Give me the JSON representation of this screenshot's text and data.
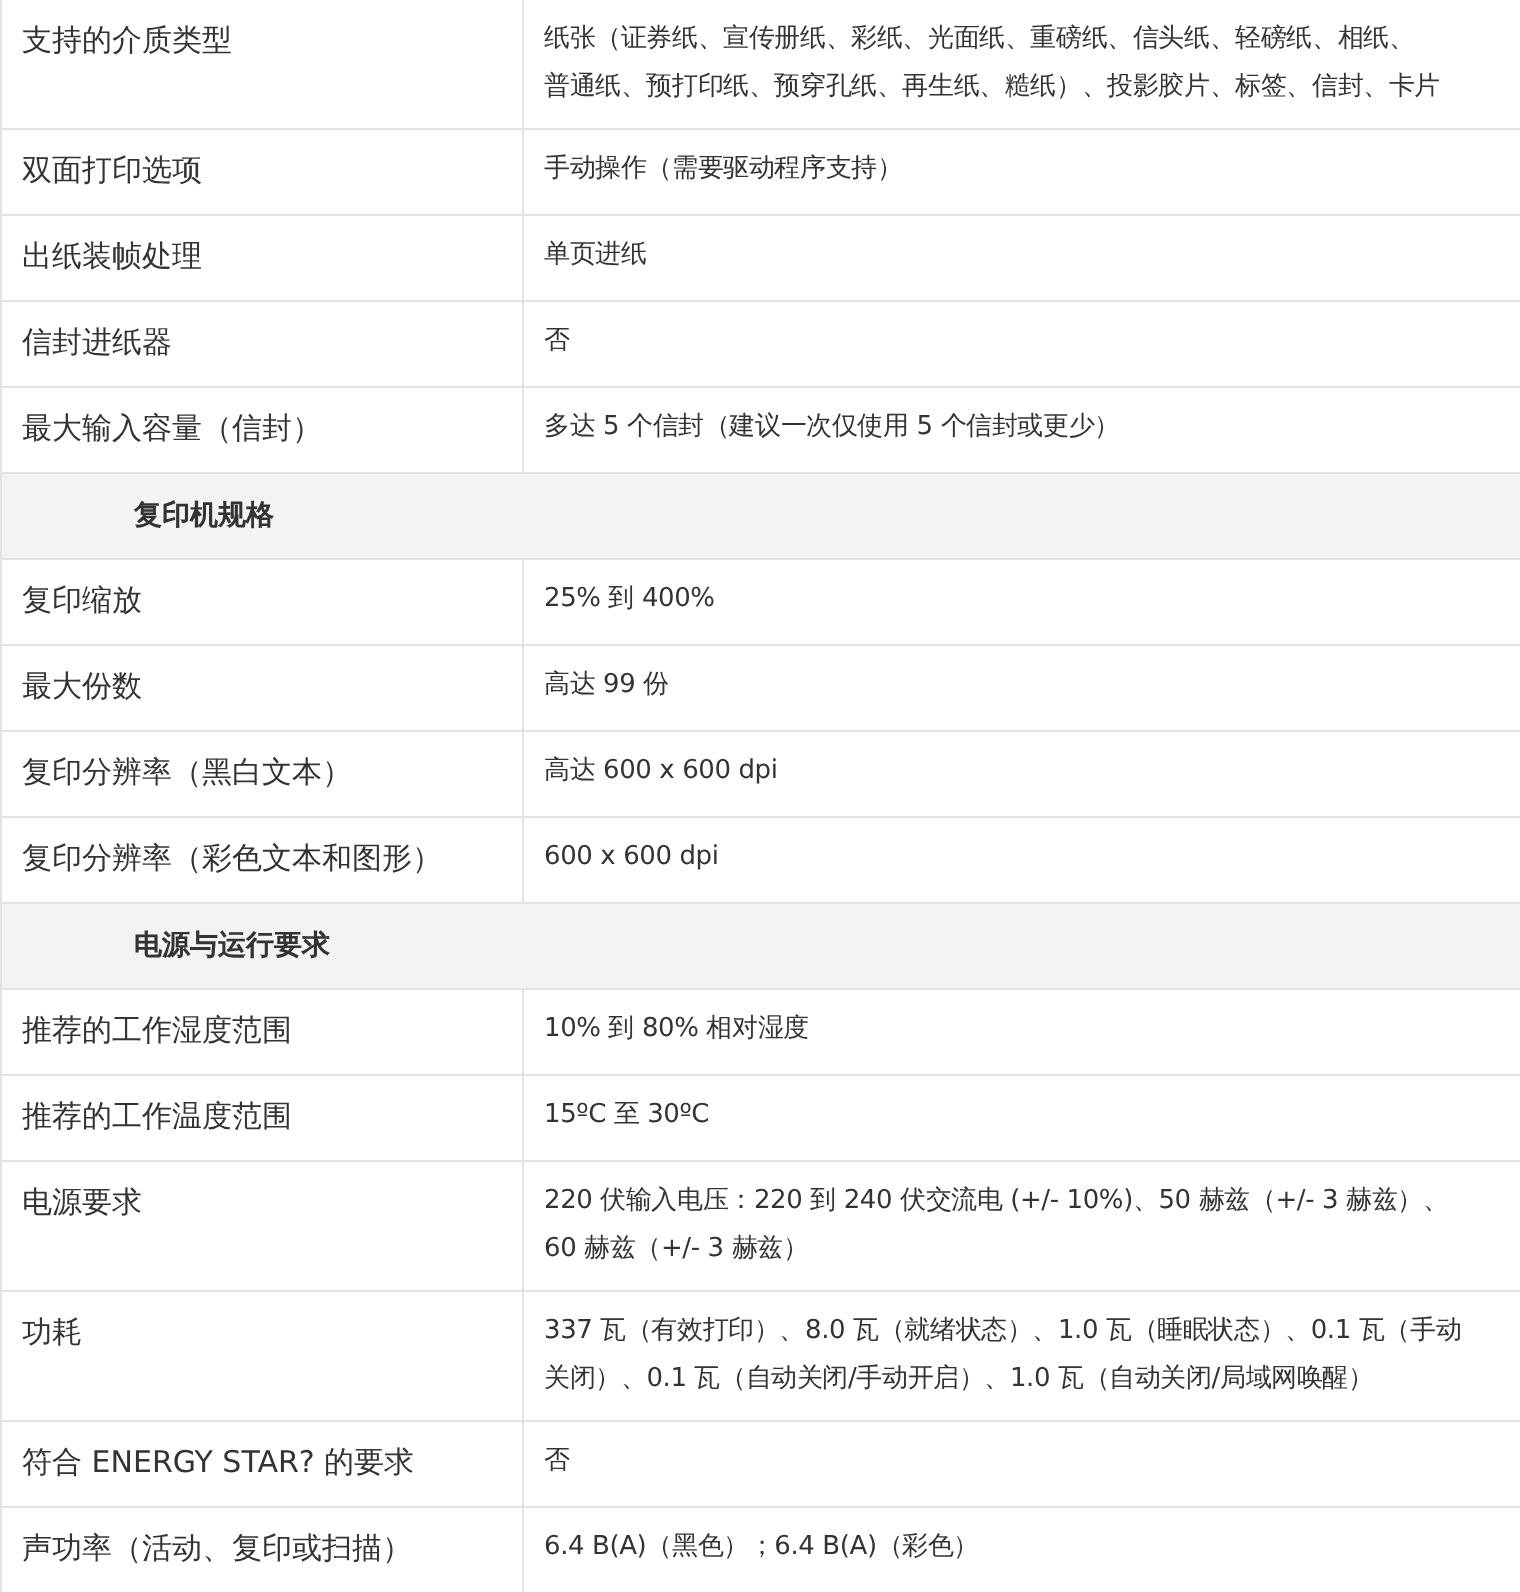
{
  "rows": [
    {
      "kind": "spec",
      "label": "支持的介质类型",
      "lines": [
        "纸张（证券纸、宣传册纸、彩纸、光面纸、重磅纸、信头纸、轻磅纸、相纸、",
        "普通纸、预打印纸、预穿孔纸、再生纸、糙纸）、投影胶片、标签、信封、卡片"
      ]
    },
    {
      "kind": "spec",
      "label": "双面打印选项",
      "lines": [
        "手动操作（需要驱动程序支持）"
      ]
    },
    {
      "kind": "spec",
      "label": "出纸装帧处理",
      "lines": [
        "单页进纸"
      ]
    },
    {
      "kind": "spec",
      "label": "信封进纸器",
      "lines": [
        "否"
      ]
    },
    {
      "kind": "spec",
      "label": "最大输入容量（信封）",
      "lines": [
        "多达 5 个信封（建议一次仅使用 5 个信封或更少）"
      ]
    },
    {
      "kind": "section",
      "label": "复印机规格"
    },
    {
      "kind": "spec",
      "label": "复印缩放",
      "lines": [
        "25% 到 400%"
      ]
    },
    {
      "kind": "spec",
      "label": "最大份数",
      "lines": [
        "高达 99 份"
      ]
    },
    {
      "kind": "spec",
      "label": "复印分辨率（黑白文本）",
      "lines": [
        "高达 600 x 600 dpi"
      ]
    },
    {
      "kind": "spec",
      "label": "复印分辨率（彩色文本和图形）",
      "lines": [
        "600 x 600 dpi"
      ]
    },
    {
      "kind": "section",
      "label": "电源与运行要求"
    },
    {
      "kind": "spec",
      "label": "推荐的工作湿度范围",
      "lines": [
        "10% 到 80% 相对湿度"
      ]
    },
    {
      "kind": "spec",
      "label": "推荐的工作温度范围",
      "lines": [
        "15ºC 至 30ºC"
      ]
    },
    {
      "kind": "spec",
      "label": "电源要求",
      "lines": [
        "220 伏输入电压：220 到 240 伏交流电 (+/- 10%)、50 赫兹（+/- 3 赫兹）、",
        "60 赫兹（+/- 3 赫兹）"
      ]
    },
    {
      "kind": "spec",
      "label": "功耗",
      "lines": [
        "337 瓦（有效打印）、8.0 瓦（就绪状态）、1.0 瓦（睡眠状态）、0.1 瓦（手动",
        "关闭）、0.1 瓦（自动关闭/手动开启）、1.0 瓦（自动关闭/局域网唤醒）"
      ]
    },
    {
      "kind": "spec",
      "label": "符合 ENERGY STAR? 的要求",
      "lines": [
        "否"
      ]
    },
    {
      "kind": "spec",
      "label": "声功率（活动、复印或扫描）",
      "lines": [
        "6.4 B(A)（黑色）；6.4 B(A)（彩色）"
      ]
    }
  ]
}
